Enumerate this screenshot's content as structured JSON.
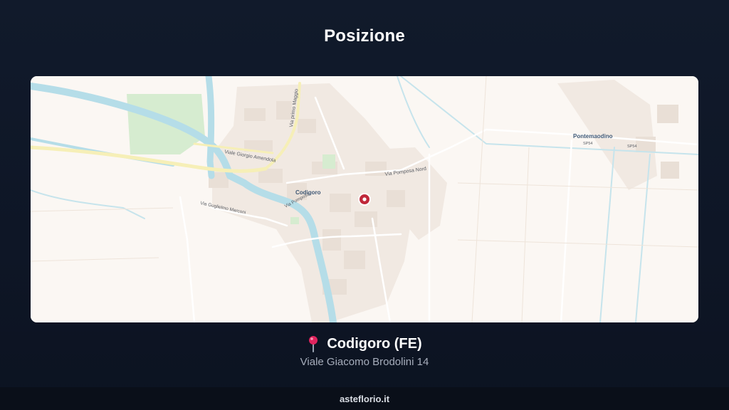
{
  "page": {
    "title": "Posizione"
  },
  "map": {
    "labels": {
      "town": "Codigoro",
      "village": "Pontemaodino",
      "street_amendola": "Viale Giorgio Amendola",
      "street_primo_maggio": "Via primo Maggio",
      "street_pomposa_nord": "Via Pomposa Nord",
      "street_marconi": "Via Guglielmo Marconi",
      "street_pomposa": "Via Pomposa",
      "road_sp54_a": "SP54",
      "road_sp54_b": "SP54"
    },
    "colors": {
      "background": "#fbf7f3",
      "water": "#b5dde8",
      "park": "#d6ecd0",
      "major_road": "#f6efb7",
      "marker": "#c0283a"
    }
  },
  "location": {
    "icon": "pushpin-icon",
    "name": "Codigoro (FE)",
    "address": "Viale Giacomo Brodolini 14"
  },
  "footer": {
    "brand": "asteflorio.it"
  }
}
